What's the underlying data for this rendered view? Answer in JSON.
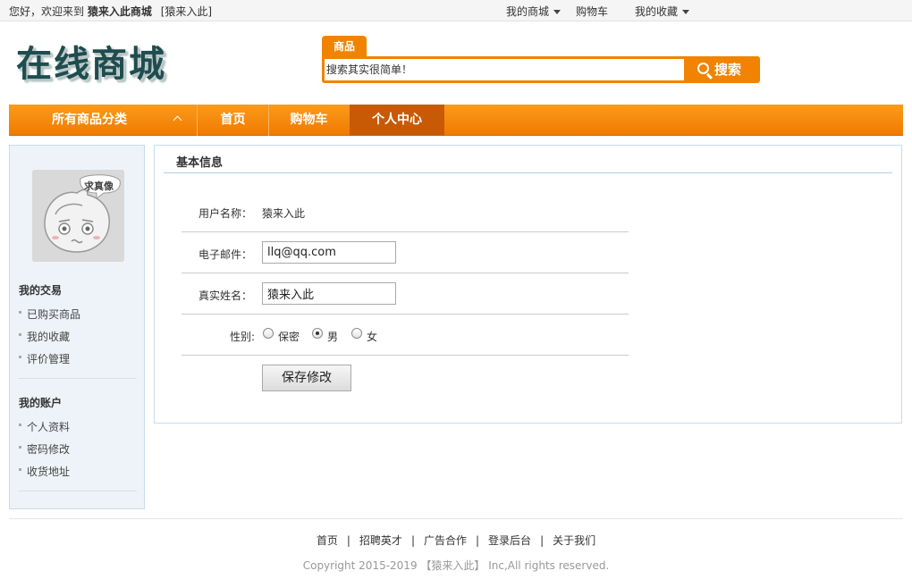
{
  "topbar": {
    "welcome_prefix": "您好，欢迎来到",
    "site_name": "猿来入此商城",
    "user": "[猿来入此]",
    "links": [
      {
        "label": "我的商城",
        "dropdown": true
      },
      {
        "label": "购物车",
        "dropdown": false
      },
      {
        "label": "我的收藏",
        "dropdown": true
      }
    ]
  },
  "logo": {
    "text": "在线商城"
  },
  "search": {
    "tab_label": "商品",
    "placeholder": "搜索其实很简单！",
    "button_label": "搜索",
    "accent_color": "#f08300"
  },
  "nav": {
    "category_label": "所有商品分类",
    "items": [
      {
        "label": "首页",
        "active": false
      },
      {
        "label": "购物车",
        "active": false
      },
      {
        "label": "个人中心",
        "active": true
      }
    ]
  },
  "sidebar": {
    "avatar_badge": "求真像",
    "sections": [
      {
        "title": "我的交易",
        "items": [
          "已购买商品",
          "我的收藏",
          "评价管理"
        ]
      },
      {
        "title": "我的账户",
        "items": [
          "个人资料",
          "密码修改",
          "收货地址"
        ]
      }
    ]
  },
  "profile": {
    "section_title": "基本信息",
    "username_label": "用户名称：",
    "username_value": "猿来入此",
    "email_label": "电子邮件：",
    "email_value": "llq@qq.com",
    "realname_label": "真实姓名：",
    "realname_value": "猿来入此",
    "gender_label": "性别:",
    "gender_options": [
      "保密",
      "男",
      "女"
    ],
    "gender_selected": "男",
    "save_label": "保存修改"
  },
  "footer": {
    "links": [
      "首页",
      "招聘英才",
      "广告合作",
      "登录后台",
      "关于我们"
    ],
    "copyright": "Copyright 2015-2019 【猿来入此】 Inc,All rights reserved."
  }
}
